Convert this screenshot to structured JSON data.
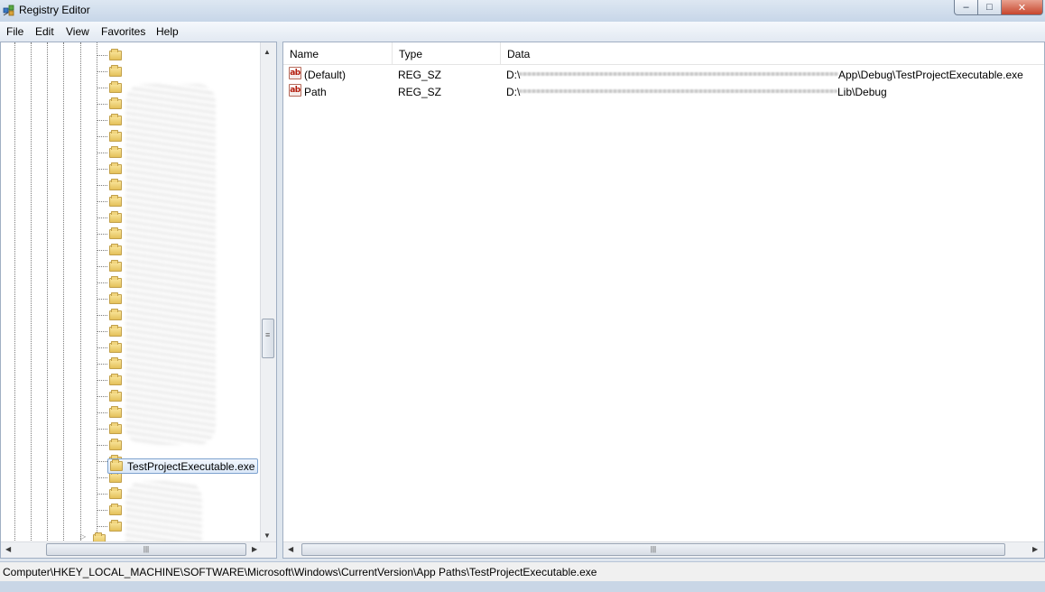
{
  "window": {
    "title": "Registry Editor"
  },
  "menu": [
    "File",
    "Edit",
    "View",
    "Favorites",
    "Help"
  ],
  "tree": {
    "selected_key": "TestProjectExecutable.exe"
  },
  "values": {
    "columns": [
      "Name",
      "Type",
      "Data"
    ],
    "rows": [
      {
        "name": "(Default)",
        "type": "REG_SZ",
        "data_prefix": "D:\\",
        "data_suffix": "App\\Debug\\TestProjectExecutable.exe"
      },
      {
        "name": "Path",
        "type": "REG_SZ",
        "data_prefix": "D:\\",
        "data_suffix": "Lib\\Debug"
      }
    ]
  },
  "statusbar": {
    "path": "Computer\\HKEY_LOCAL_MACHINE\\SOFTWARE\\Microsoft\\Windows\\CurrentVersion\\App Paths\\TestProjectExecutable.exe"
  },
  "icons": {
    "app": "registry-editor-icon",
    "string_value": "reg-sz-icon",
    "folder": "folder-icon"
  },
  "colors": {
    "selection_border": "#7da2ce",
    "string_icon": "#b21a0a"
  }
}
